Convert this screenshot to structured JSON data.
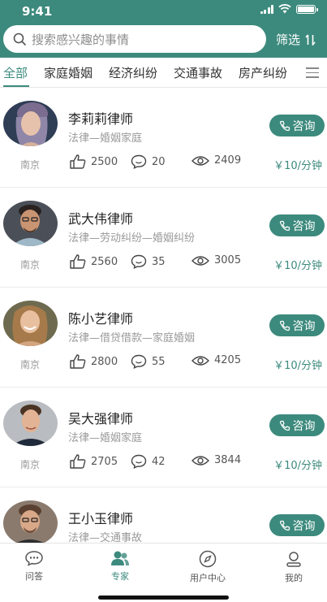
{
  "status": {
    "time": "9:41"
  },
  "search": {
    "placeholder": "搜索感兴趣的事情"
  },
  "filter": {
    "label": "筛选"
  },
  "tabs": [
    "全部",
    "家庭婚姻",
    "经济纠纷",
    "交通事故",
    "房产纠纷"
  ],
  "active_tab": "全部",
  "lawyers": [
    {
      "name": "李莉莉律师",
      "specialty": "法律—婚姻家庭",
      "city": "南京",
      "likes": "2500",
      "comments": "20",
      "views": "2409",
      "price": "￥10/分钟",
      "consult_label": "咨询"
    },
    {
      "name": "武大伟律师",
      "specialty": "法律—劳动纠纷—婚姻纠纷",
      "city": "南京",
      "likes": "2560",
      "comments": "35",
      "views": "3005",
      "price": "￥10/分钟",
      "consult_label": "咨询"
    },
    {
      "name": "陈小艺律师",
      "specialty": "法律—借贷借款—家庭婚姻",
      "city": "南京",
      "likes": "2800",
      "comments": "55",
      "views": "4205",
      "price": "￥10/分钟",
      "consult_label": "咨询"
    },
    {
      "name": "吴大强律师",
      "specialty": "法律—婚姻家庭",
      "city": "南京",
      "likes": "2705",
      "comments": "42",
      "views": "3844",
      "price": "￥10/分钟",
      "consult_label": "咨询"
    },
    {
      "name": "王小玉律师",
      "specialty": "法律—交通事故",
      "consult_label": "咨询"
    }
  ],
  "tabbar": [
    {
      "label": "问答",
      "icon": "chat-bubble-icon"
    },
    {
      "label": "专家",
      "icon": "experts-icon"
    },
    {
      "label": "用户中心",
      "icon": "compass-icon"
    },
    {
      "label": "我的",
      "icon": "profile-icon"
    }
  ],
  "colors": {
    "primary": "#3c8a7d",
    "text": "#333333",
    "muted": "#9a9a9a"
  }
}
